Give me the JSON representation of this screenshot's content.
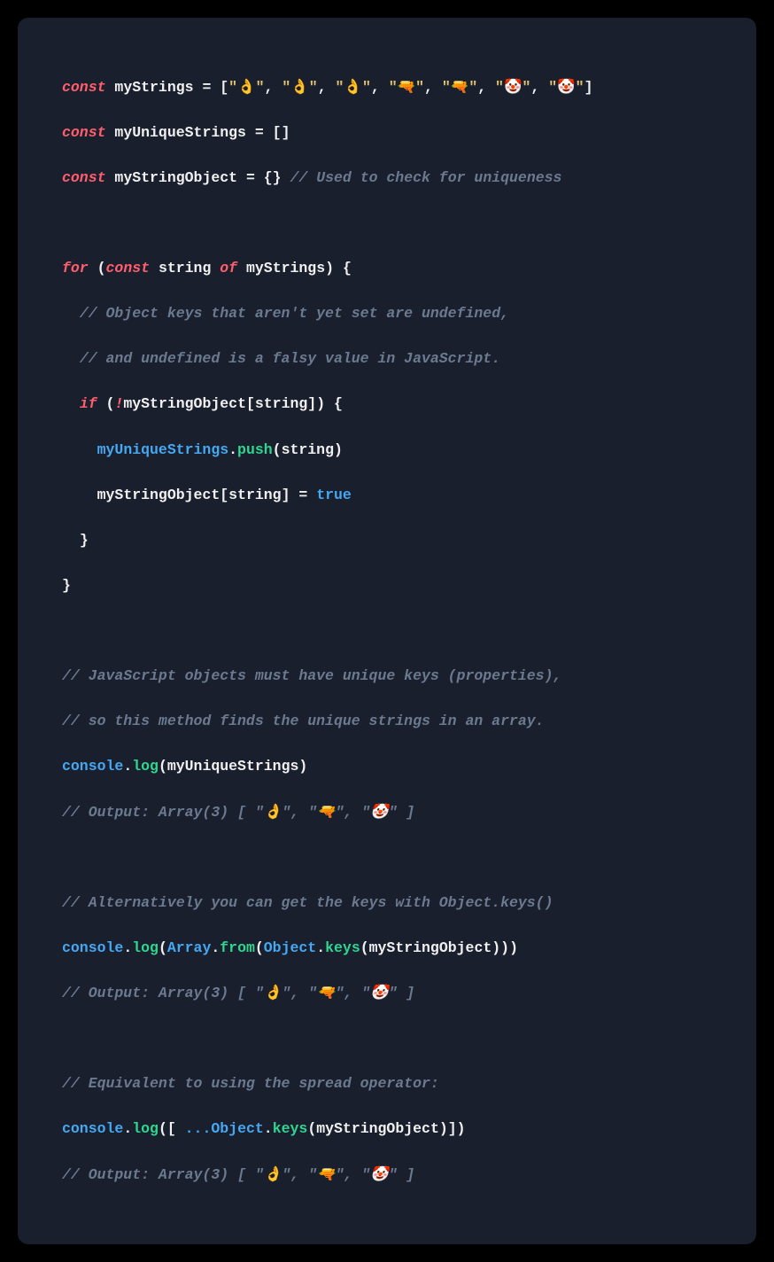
{
  "emoji": {
    "ok": "👌",
    "gun": "🔫",
    "clown": "🤡"
  },
  "tokens": {
    "const": "const",
    "for": "for",
    "of": "of",
    "if": "if",
    "not": "!",
    "true": "true",
    "console": "console",
    "log": "log",
    "push": "push",
    "from": "from",
    "keys": "keys",
    "Array": "Array",
    "Object": "Object",
    "spread": "..."
  },
  "names": {
    "myStrings": "myStrings",
    "myUniqueStrings": "myUniqueStrings",
    "myStringObject": "myStringObject",
    "string": "string"
  },
  "comments": {
    "c1": "// Used to check for uniqueness",
    "c2": "// Object keys that aren't yet set are undefined,",
    "c3": "// and undefined is a falsy value in JavaScript.",
    "c4": "// JavaScript objects must have unique keys (properties),",
    "c5": "// so this method finds the unique strings in an array.",
    "c6a": "// Output: Array(3) [ \"",
    "c6b": "\", \"",
    "c6c": "\" ]",
    "c7": "// Alternatively you can get the keys with Object.keys()",
    "c8": "// Equivalent to using the spread operator:"
  },
  "lits": {
    "eq": " = ",
    "open_sq": "[",
    "close_sq": "]",
    "open_cu": "{",
    "close_cu": "}",
    "open_pa": "(",
    "close_pa": ")",
    "comma": ", ",
    "dot": ".",
    "empty_arr": "[]",
    "empty_obj": "{}",
    "space": " ",
    "q": "\""
  }
}
